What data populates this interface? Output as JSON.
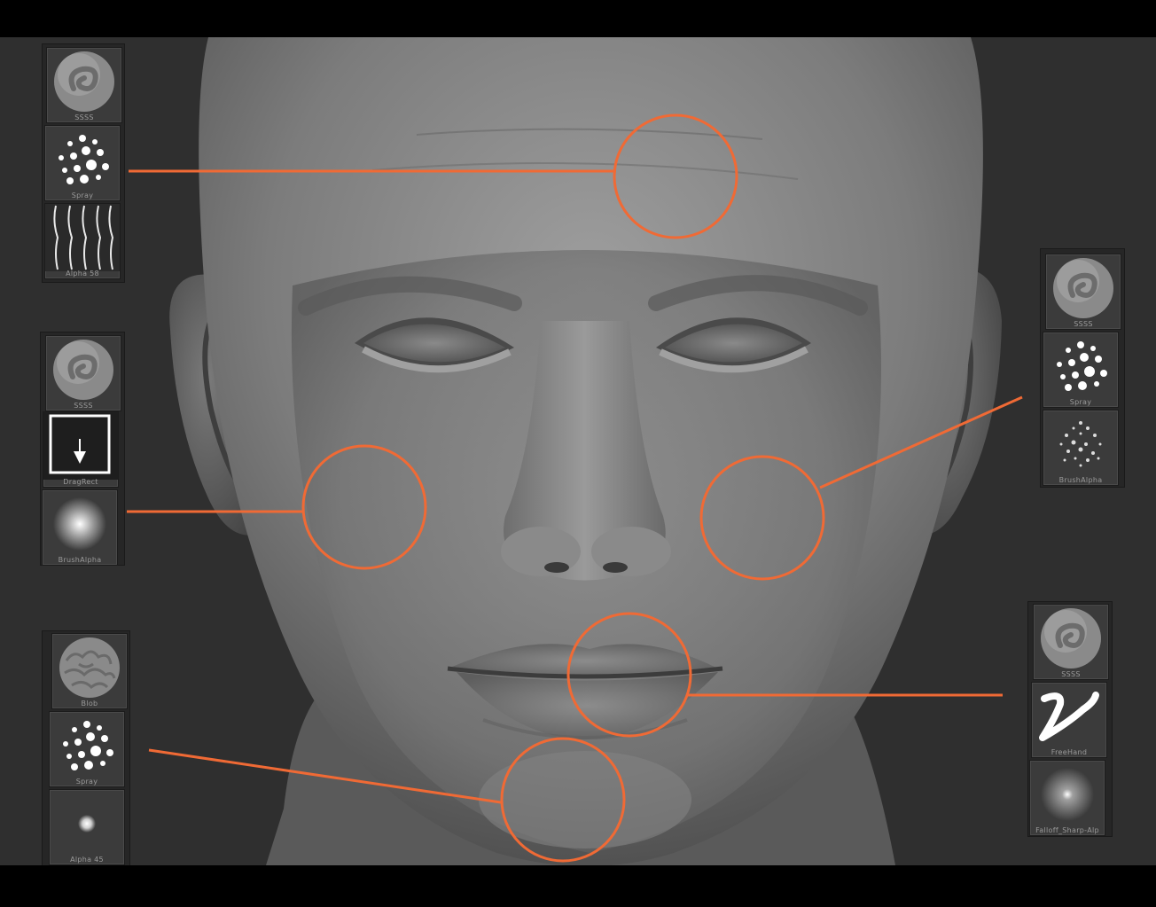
{
  "colors": {
    "callout": "#f06a35",
    "background": "#2f2f2f",
    "letterbox": "#000000",
    "panel": "#262626",
    "tile": "#3b3b3b",
    "label": "#9a9a9a"
  },
  "panels": {
    "forehead": {
      "material": "SSSS",
      "stroke": "Spray",
      "alpha": "Alpha 58"
    },
    "left_cheek": {
      "material": "SSSS",
      "stroke": "DragRect",
      "alpha": "BrushAlpha"
    },
    "chin": {
      "material": "Blob",
      "stroke": "Spray",
      "alpha": "Alpha 45"
    },
    "right_cheek": {
      "material": "SSSS",
      "stroke": "Spray",
      "alpha": "BrushAlpha"
    },
    "lips": {
      "material": "SSSS",
      "stroke": "FreeHand",
      "alpha": "Falloff_Sharp-Alp"
    }
  },
  "icons": {
    "material_ssss": "sphere-material-icon",
    "material_blob": "blob-material-icon",
    "stroke_spray": "spray-stroke-icon",
    "stroke_dragrect": "dragrect-stroke-icon",
    "stroke_freehand": "freehand-stroke-icon",
    "alpha": "alpha-falloff-icon"
  }
}
